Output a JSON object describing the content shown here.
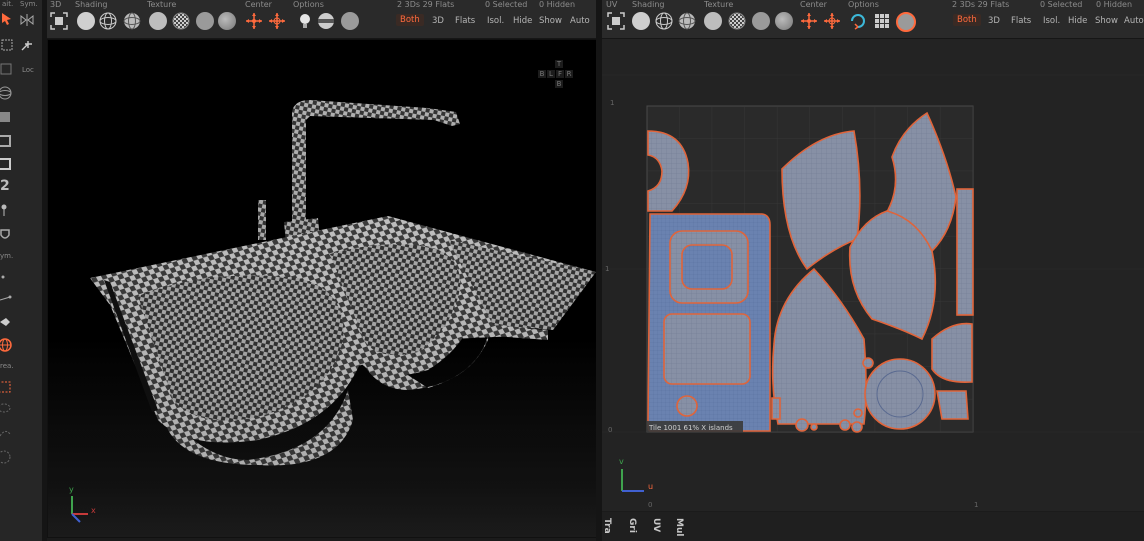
{
  "left_strip": {
    "labels": {
      "sym": "Sym.",
      "loc": "Loc",
      "num": "2",
      "sym2": "ym.",
      "area": "rea."
    }
  },
  "viewport3d_header": {
    "group_labels": {
      "view": "3D",
      "shading": "Shading",
      "texture": "Texture",
      "center": "Center",
      "options": "Options"
    },
    "status": {
      "counts": "2 3Ds 29 Flats",
      "selected": "0 Selected",
      "hidden": "0 Hidden"
    },
    "toggles": [
      "Both",
      "3D",
      "Flats",
      "Isol.",
      "Hide",
      "Show",
      "Auto"
    ],
    "active_toggle": "Both"
  },
  "viewport3d": {
    "navcube_letters": [
      "T",
      "B",
      "L",
      "F",
      "R",
      "B"
    ],
    "axis": {
      "y": "y",
      "x": "x"
    }
  },
  "uv_header": {
    "group_labels": {
      "view": "UV",
      "shading": "Shading",
      "texture": "Texture",
      "center": "Center",
      "options": "Options"
    },
    "status": {
      "counts": "2 3Ds 29 Flats",
      "selected": "0 Selected",
      "hidden": "0 Hidden"
    },
    "toggles": [
      "Both",
      "3D",
      "Flats",
      "Isol.",
      "Hide",
      "Show",
      "Auto"
    ],
    "active_toggle": "Both"
  },
  "uv_viewport": {
    "tick_labels": {
      "top_left": "1",
      "mid_left": "1",
      "bottom_left": "0",
      "bottom_zero": "0",
      "bottom_one": "1"
    },
    "tile_status": "Tile 1001 61%   X   islands",
    "axis": {
      "v": "v",
      "u": "u"
    }
  },
  "uv_footer": {
    "tabs": [
      "Tra",
      "Gri",
      "UV",
      "Mul"
    ]
  },
  "colors": {
    "accent": "#ff6a3d",
    "uv_island_fill": "#8790a5",
    "uv_island_outline": "#e0643a",
    "checker_light": "#c8c8c8",
    "checker_dark": "#4a4a4a"
  }
}
